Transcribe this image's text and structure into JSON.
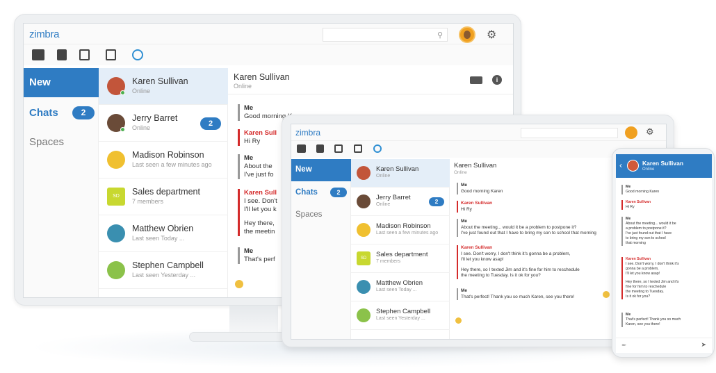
{
  "brand": {
    "logo": "zimbra",
    "accent": "#2f7cc3",
    "alert": "#d42b2b"
  },
  "nav": {
    "new": "New",
    "chats": "Chats",
    "chats_count": "2",
    "spaces": "Spaces"
  },
  "contacts": [
    {
      "name": "Karen Sullivan",
      "status": "Online",
      "badge": ""
    },
    {
      "name": "Jerry Barret",
      "status": "Online",
      "badge": "2"
    },
    {
      "name": "Madison Robinson",
      "status": "Last seen a few minutes ago",
      "badge": ""
    },
    {
      "name": "Sales department",
      "status": "7 members",
      "badge": "",
      "initials": "SD"
    },
    {
      "name": "Matthew Obrien",
      "status": "Last seen Today ...",
      "badge": ""
    },
    {
      "name": "Stephen Campbell",
      "status": "Last seen Yesterday ...",
      "badge": ""
    }
  ],
  "conversation": {
    "name": "Karen Sullivan",
    "status": "Online",
    "messages": [
      {
        "who": "Me",
        "lines": [
          "Good morning Karen"
        ]
      },
      {
        "who": "Karen Sullivan",
        "lines": [
          "Hi Ry"
        ]
      },
      {
        "who": "Me",
        "lines": [
          "About the meeting... would it be a problem to postpone it?",
          "I've just found out that I have to bring my son to school that morning"
        ]
      },
      {
        "who": "Karen Sullivan",
        "lines": [
          "I see. Don't worry, I don't think it's gonna be a problem,",
          "I'll let you know asap!",
          "",
          "Hey there, so I texted Jim and it's fine for him to reschedule",
          "the meeting to Tuesday. Is it ok for you?"
        ]
      },
      {
        "who": "Me",
        "lines": [
          "That's perfect! Thank you so much Karen, see you there!"
        ]
      }
    ]
  },
  "monitor_conv": {
    "m1_text": "Good morning Karen",
    "m2_text": "Hi Ry",
    "m3_a": "About the",
    "m3_b": "I've just fo",
    "m4_a": "I see. Don't",
    "m4_b": "I'll let you k",
    "m4_c": "Hey there,",
    "m4_d": "the meetin",
    "m5_text": "That's perf",
    "k_short": "Karen Sull"
  },
  "phone": {
    "lines_m3": [
      "About the meeting... would it be",
      "a problem to postpone it?",
      "I've just found out that I have",
      "to bring my son to school",
      "that morning"
    ],
    "lines_k1": [
      "I see. Don't worry, I don't think it's",
      "gonna be a problem,",
      "I'll let you know asap!"
    ],
    "lines_k2": [
      "Hey there, so I texted Jim and it's",
      "fine for him to reschedule",
      "the meeting to Tuesday.",
      "Is it ok for you?"
    ],
    "lines_m5": [
      "That's perfect! Thank you so much",
      "Karen, see you there!"
    ]
  },
  "icons": {
    "search": "search-icon",
    "gear": "gear-icon",
    "mail": "mail-icon",
    "contacts": "contacts-icon",
    "calendar": "calendar-icon",
    "tasks": "tasks-icon",
    "chat": "chat-icon",
    "video": "video-icon",
    "info": "info-icon",
    "attach": "attach-icon",
    "send": "send-icon",
    "back": "back-icon"
  }
}
